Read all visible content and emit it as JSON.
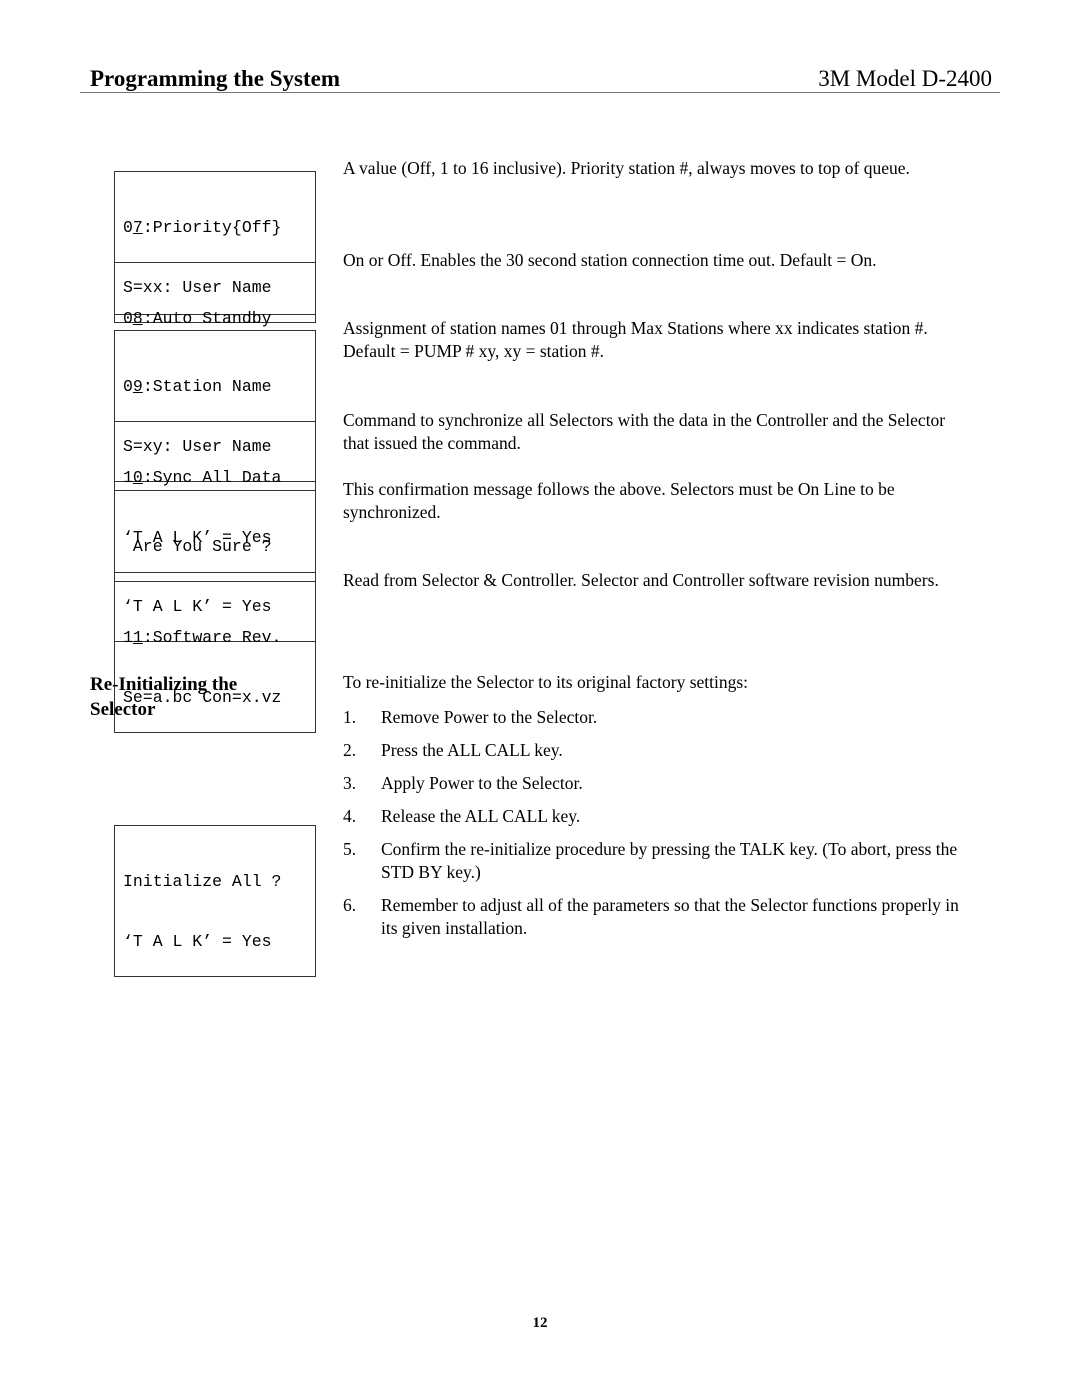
{
  "header": {
    "title": "Programming the System",
    "model": "3M Model D-2400"
  },
  "lcd_screens": [
    {
      "prefix": "0",
      "underlined": "7",
      "rest": ":Priority{Off}",
      "line2": "S=xx: User Name"
    },
    {
      "prefix": "0",
      "underlined": "8",
      "rest": ":Auto Standby",
      "line2": ""
    },
    {
      "prefix": "0",
      "underlined": "9",
      "rest": ":Station Name",
      "line2": "S=xy: User Name"
    },
    {
      "prefix": "1",
      "underlined": "0",
      "rest": ":Sync All Data",
      "line2": "‘T A L K’ = Yes"
    },
    {
      "prefix": "",
      "underlined": "",
      "rest": " Are You Sure ?",
      "line2": "‘T A L K’ = Yes"
    },
    {
      "prefix": "1",
      "underlined": "1",
      "rest": ":Software Rev.",
      "line2": "Se=a.bc Con=x.vz"
    },
    {
      "prefix": "",
      "underlined": "",
      "rest": "Initialize All ?",
      "line2": "‘T A L K’ = Yes"
    }
  ],
  "descriptions": [
    "A value (Off, 1 to 16 inclusive). Priority station #, always moves to top of queue.",
    "On or Off.  Enables the 30 second station connection time out.  Default = On.",
    "Assignment of station names 01 through Max Stations where xx indicates station #.  Default = PUMP #  xy, xy = station #.",
    "Command to synchronize all Selectors with the data in the Controller and the Selector that issued the command.",
    "This confirmation message follows the above.  Selectors must be On Line to be synchronized.",
    "Read from Selector & Controller.  Selector and Controller software revision numbers."
  ],
  "reinit": {
    "heading": "Re-Initializing the Selector",
    "intro": "To re-initialize the Selector to its original factory settings:",
    "steps": [
      {
        "num": "1.",
        "text": "Remove Power to the Selector."
      },
      {
        "num": "2.",
        "text": "Press the ALL CALL key."
      },
      {
        "num": "3.",
        "text": "Apply Power to the Selector."
      },
      {
        "num": "4.",
        "text": "Release the ALL CALL key."
      },
      {
        "num": "5.",
        "text": "Confirm the re-initialize procedure by pressing the TALK key.  (To abort, press the STD BY key.)"
      },
      {
        "num": "6.",
        "text": "Remember to adjust all of the parameters so that the Selector functions properly in its given installation."
      }
    ]
  },
  "page_number": "12"
}
